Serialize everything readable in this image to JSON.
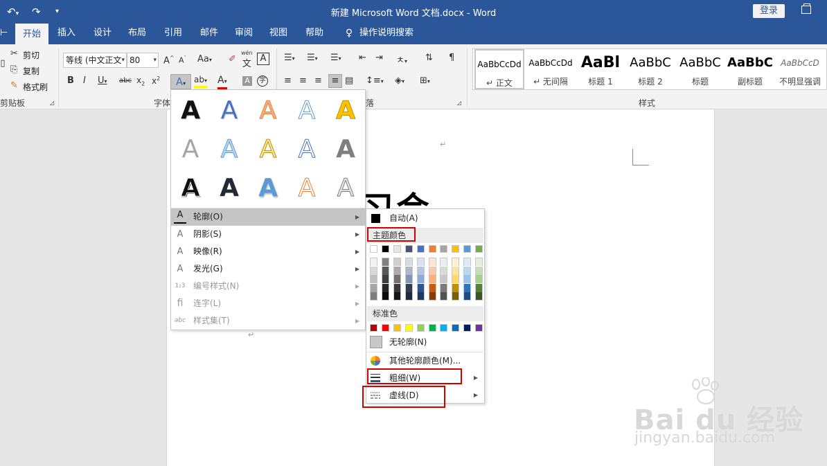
{
  "title_bar": {
    "title": "新建 Microsoft Word 文档.docx  -  Word",
    "login": "登录"
  },
  "tabs": [
    {
      "label": "开始",
      "active": true
    },
    {
      "label": "插入"
    },
    {
      "label": "设计"
    },
    {
      "label": "布局"
    },
    {
      "label": "引用"
    },
    {
      "label": "邮件"
    },
    {
      "label": "审阅"
    },
    {
      "label": "视图"
    },
    {
      "label": "帮助"
    },
    {
      "label": "操作说明搜索"
    }
  ],
  "ribbon": {
    "clipboard": {
      "cut": "剪切",
      "copy": "复制",
      "format_painter": "格式刷",
      "group": "剪贴板"
    },
    "font": {
      "font_name": "等线 (中文正文",
      "font_size": "80",
      "case_label": "Aa",
      "group": "字体",
      "pinyin": "wén"
    },
    "paragraph": {
      "group": "落"
    },
    "styles": {
      "group": "样式",
      "items": [
        {
          "preview": "AaBbCcDd",
          "name": "↵ 正文"
        },
        {
          "preview": "AaBbCcDd",
          "name": "↵ 无间隔"
        },
        {
          "preview": "AaBl",
          "name": "标题 1"
        },
        {
          "preview": "AaBbC",
          "name": "标题 2"
        },
        {
          "preview": "AaBbC",
          "name": "标题"
        },
        {
          "preview": "AaBbC",
          "name": "副标题"
        },
        {
          "preview": "AaBbCcD",
          "name": "不明显强调"
        }
      ]
    }
  },
  "document": {
    "big_text": "习会",
    "para_mark": "↵"
  },
  "text_effects_menu": {
    "samples": [
      {
        "glyph": "A",
        "color": "#111111"
      },
      {
        "glyph": "A",
        "color": "#4472c4"
      },
      {
        "glyph": "A",
        "color": "#f4b183"
      },
      {
        "glyph": "A",
        "color": "#ffffff"
      },
      {
        "glyph": "A",
        "color": "#ffc000"
      },
      {
        "glyph": "A",
        "color": "#a5a5a5"
      },
      {
        "glyph": "A",
        "color": "#bdd7ee"
      },
      {
        "glyph": "A",
        "color": "#ffe699"
      },
      {
        "glyph": "A",
        "color": "#ffffff"
      },
      {
        "glyph": "A",
        "color": "#7f7f7f"
      },
      {
        "glyph": "A",
        "color": "#111111"
      },
      {
        "glyph": "A",
        "color": "#222a35"
      },
      {
        "glyph": "A",
        "color": "#5b9bd5"
      },
      {
        "glyph": "A",
        "color": "#ffffff"
      },
      {
        "glyph": "A",
        "color": "#e7e6e6"
      }
    ],
    "items": [
      {
        "label": "轮廓(O)",
        "icon": "A",
        "highlight": true
      },
      {
        "label": "阴影(S)",
        "icon": "A"
      },
      {
        "label": "映像(R)",
        "icon": "A"
      },
      {
        "label": "发光(G)",
        "icon": "A"
      },
      {
        "label": "编号样式(N)",
        "icon": "1₂3",
        "disabled": true
      },
      {
        "label": "连字(L)",
        "icon": "fi",
        "disabled": true
      },
      {
        "label": "样式集(T)",
        "icon": "abc",
        "disabled": true
      }
    ]
  },
  "outline_menu": {
    "auto": "自动(A)",
    "theme_colors_label": "主题颜色",
    "theme_top": [
      "#ffffff",
      "#000000",
      "#e7e6e6",
      "#44546a",
      "#4472c4",
      "#ed7d31",
      "#a5a5a5",
      "#ffc000",
      "#5b9bd5",
      "#70ad47"
    ],
    "theme_shades": [
      [
        "#f2f2f2",
        "#808080",
        "#d0cece",
        "#d6dce4",
        "#d9e2f3",
        "#fbe5d5",
        "#ededed",
        "#fff2cc",
        "#deebf6",
        "#e2efd9"
      ],
      [
        "#d8d8d8",
        "#595959",
        "#aeaaaa",
        "#adb9ca",
        "#b4c6e7",
        "#f7cbac",
        "#dbdbdb",
        "#fee599",
        "#bdd7ee",
        "#c5e0b3"
      ],
      [
        "#bfbfbf",
        "#3f3f3f",
        "#757070",
        "#8496b0",
        "#8eaadb",
        "#f4b183",
        "#c9c9c9",
        "#ffd965",
        "#9cc3e5",
        "#a8d08d"
      ],
      [
        "#a5a5a5",
        "#262626",
        "#3a3838",
        "#323f4f",
        "#2f5496",
        "#c55a11",
        "#7b7b7b",
        "#bf9000",
        "#2e75b5",
        "#538135"
      ],
      [
        "#7f7f7f",
        "#0c0c0c",
        "#171616",
        "#222a35",
        "#1f3864",
        "#833c0b",
        "#525252",
        "#7f6000",
        "#1e4e79",
        "#375623"
      ]
    ],
    "standard_label": "标准色",
    "standard_colors": [
      "#c00000",
      "#ff0000",
      "#ffc000",
      "#ffff00",
      "#92d050",
      "#00b050",
      "#00b0f0",
      "#0070c0",
      "#002060",
      "#7030a0"
    ],
    "no_outline": "无轮廓(N)",
    "more_colors": "其他轮廓颜色(M)...",
    "weight": "粗细(W)",
    "dashes": "虚线(D)"
  },
  "watermark": {
    "brand": "Bai du 经验",
    "url": "jingyan.baidu.com"
  }
}
